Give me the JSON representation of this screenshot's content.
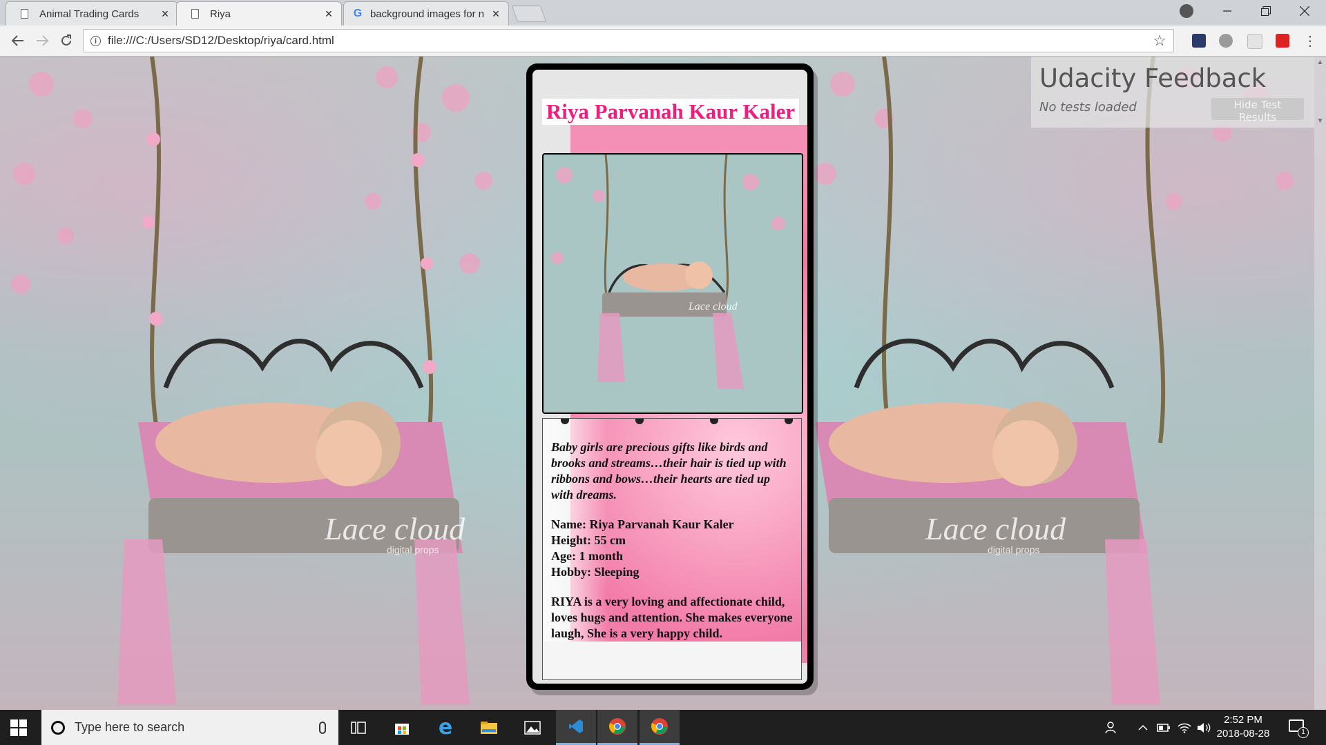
{
  "browser": {
    "tabs": [
      {
        "label": "Animal Trading Cards",
        "icon": "page-icon",
        "active": false
      },
      {
        "label": "Riya",
        "icon": "page-icon",
        "active": true
      },
      {
        "label": "background images for n",
        "icon": "google-icon",
        "active": false
      }
    ],
    "close_glyph": "×",
    "url": "file:///C:/Users/SD12/Desktop/riya/card.html"
  },
  "card": {
    "title": "Riya Parvanah Kaur Kaler",
    "watermark": "Lace cloud",
    "quote": "Baby girls are precious gifts like birds and brooks and streams…their hair is tied up with ribbons and bows…their hearts are tied up with dreams.",
    "facts": {
      "name": "Name: Riya Parvanah Kaur Kaler",
      "height": "Height: 55 cm",
      "age": "Age: 1 month",
      "hobby": "Hobby: Sleeping"
    },
    "bio": "RIYA is a very loving and affectionate child, loves hugs and attention. She makes everyone laugh, She is a very happy child."
  },
  "background": {
    "watermark": "Lace cloud",
    "watermark_sub": "digital props"
  },
  "feedback": {
    "title": "Udacity Feedback",
    "status": "No tests loaded",
    "button": "Hide Test Results"
  },
  "taskbar": {
    "search_placeholder": "Type here to search",
    "time": "2:52 PM",
    "date": "2018-08-28",
    "notification_count": "1"
  },
  "colors": {
    "title_pink": "#ef1e7e",
    "taskbar": "#1f1f1f",
    "chrome_tab_active": "#f2f2f2"
  }
}
